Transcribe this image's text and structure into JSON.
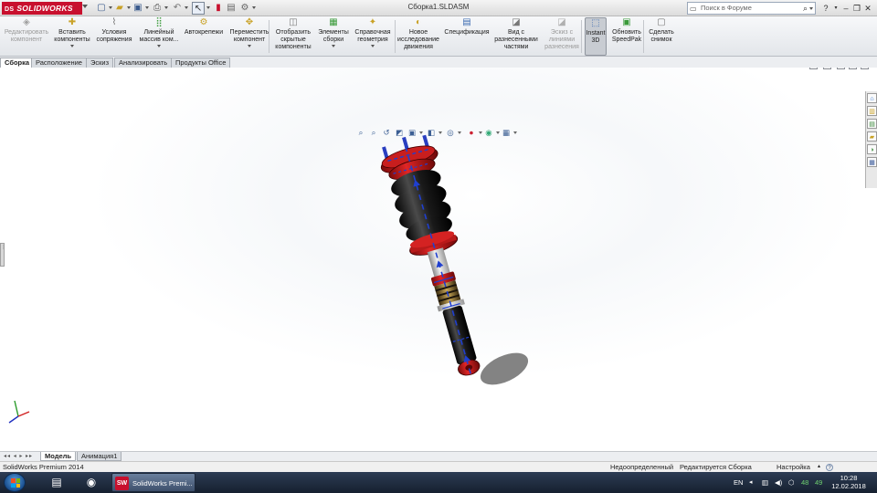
{
  "titlebar": {
    "logo_prefix": "DS",
    "logo_text": "SOLIDWORKS",
    "document_title": "Сборка1.SLDASM",
    "search_placeholder": "Поиск в Форуме",
    "quick_access_icons": [
      "new-icon",
      "open-icon",
      "save-icon",
      "print-icon",
      "undo-icon",
      "select-icon",
      "rebuild-icon",
      "file-properties-icon",
      "options-icon"
    ]
  },
  "ribbon": {
    "buttons": [
      {
        "label": "Редактировать\nкомпонент",
        "icon": "edit-component-icon",
        "disabled": true,
        "dropdown": false
      },
      {
        "label": "Вставить\nкомпоненты",
        "icon": "insert-components-icon",
        "disabled": false,
        "dropdown": true
      },
      {
        "label": "Условия\nсопряжения",
        "icon": "mate-icon",
        "disabled": false,
        "dropdown": false
      },
      {
        "label": "Линейный\nмассив ком...",
        "icon": "linear-pattern-icon",
        "disabled": false,
        "dropdown": true
      },
      {
        "label": "Автокрепежи",
        "icon": "smart-fasteners-icon",
        "disabled": false,
        "dropdown": false
      },
      {
        "label": "Переместить\nкомпонент",
        "icon": "move-component-icon",
        "disabled": false,
        "dropdown": true
      },
      {
        "label": "Отобразить\nскрытые\nкомпоненты",
        "icon": "show-hidden-icon",
        "disabled": false,
        "dropdown": false
      },
      {
        "label": "Элементы\nсборки",
        "icon": "assembly-features-icon",
        "disabled": false,
        "dropdown": true
      },
      {
        "label": "Справочная\nгеометрия",
        "icon": "reference-geometry-icon",
        "disabled": false,
        "dropdown": true
      },
      {
        "label": "Новое\nисследование\nдвижения",
        "icon": "motion-study-icon",
        "disabled": false,
        "dropdown": false
      },
      {
        "label": "Спецификация",
        "icon": "bom-icon",
        "disabled": false,
        "dropdown": false
      },
      {
        "label": "Вид с\nразнесенными\nчастями",
        "icon": "exploded-view-icon",
        "disabled": false,
        "dropdown": false
      },
      {
        "label": "Эскиз с\nлиниями\nразнесения",
        "icon": "explode-line-sketch-icon",
        "disabled": true,
        "dropdown": false
      },
      {
        "label": "Instant\n3D",
        "icon": "instant3d-icon",
        "disabled": false,
        "dropdown": false,
        "active": true
      },
      {
        "label": "Обновить\nSpeedPak",
        "icon": "speedpak-icon",
        "disabled": false,
        "dropdown": false
      },
      {
        "label": "Сделать\nснимок",
        "icon": "snapshot-icon",
        "disabled": false,
        "dropdown": false
      }
    ]
  },
  "tabs": [
    "Сборка",
    "Расположение",
    "Эскиз",
    "Анализировать",
    "Продукты Office"
  ],
  "active_tab": 0,
  "viewport": {
    "hud_icons": [
      "zoom-to-fit-icon",
      "zoom-area-icon",
      "previous-view-icon",
      "section-view-icon",
      "view-orientation-icon",
      "display-style-icon",
      "hide-show-icon",
      "edit-appearance-icon",
      "apply-scene-icon",
      "view-settings-icon"
    ],
    "window_buttons": [
      "□",
      "▭",
      "⧉",
      "✕"
    ],
    "taskpane_icons": [
      "resources-icon",
      "design-library-icon",
      "file-explorer-icon",
      "view-palette-icon",
      "appearances-icon",
      "custom-properties-icon"
    ],
    "colors": {
      "red": "#c41e1e",
      "black": "#1b1b1b",
      "blue": "#1f3fd0",
      "steel": "#dcdcdc"
    }
  },
  "bottom_tabs": [
    "Модель",
    "Анимация1"
  ],
  "statusbar": {
    "product": "SolidWorks Premium 2014",
    "definition": "Недоопределенный",
    "mode": "Редактируется Сборка",
    "units": "Настройка"
  },
  "taskbar": {
    "active_task": "SolidWorks Premi...",
    "language": "EN",
    "tray_num_1": "48",
    "tray_num_2": "49",
    "time": "10:28",
    "date": "12.02.2018"
  }
}
